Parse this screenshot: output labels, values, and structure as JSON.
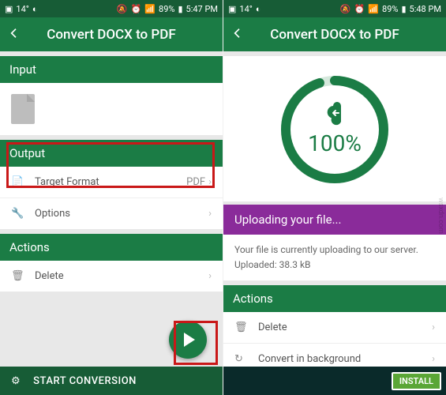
{
  "left": {
    "status": {
      "temp": "14°",
      "battery": "89%",
      "time": "5:47 PM"
    },
    "title": "Convert DOCX to PDF",
    "input": {
      "header": "Input"
    },
    "output": {
      "header": "Output",
      "target_format_label": "Target Format",
      "target_format_value": "PDF",
      "options_label": "Options"
    },
    "actions": {
      "header": "Actions",
      "delete_label": "Delete"
    },
    "start_label": "START CONVERSION"
  },
  "right": {
    "status": {
      "temp": "14°",
      "battery": "89%",
      "time": "5:48 PM"
    },
    "title": "Convert DOCX to PDF",
    "progress": {
      "percent": "100%",
      "value": 100
    },
    "upload": {
      "header": "Uploading your file...",
      "msg": "Your file is currently uploading to our server.",
      "uploaded_label": "Uploaded: 38.3 kB"
    },
    "actions": {
      "header": "Actions",
      "delete_label": "Delete",
      "bg_label": "Convert in background"
    },
    "ad": {
      "install": "INSTALL"
    }
  },
  "watermark": "wsxdn.com"
}
